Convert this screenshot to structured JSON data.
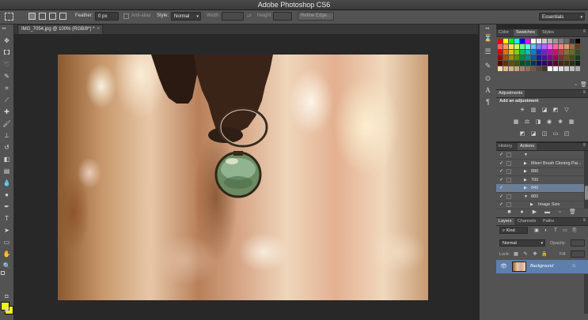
{
  "app": {
    "title": "Adobe Photoshop CS6"
  },
  "options_bar": {
    "feather_label": "Feather:",
    "feather_value": "0 px",
    "anti_alias_label": "Anti-alias",
    "style_label": "Style:",
    "style_value": "Normal",
    "width_label": "Width:",
    "height_label": "Height:",
    "refine_edge_label": "Refine Edge...",
    "workspace_value": "Essentials"
  },
  "document": {
    "tab_label": "IMG_7054.jpg @ 100% (RGB/8*) *"
  },
  "color_panel": {
    "tabs": [
      "Color",
      "Swatches",
      "Styles"
    ],
    "active_tab": "Swatches",
    "swatch_colors": [
      "#ff0000",
      "#ffff00",
      "#00ff00",
      "#00ffff",
      "#0000ff",
      "#ff00ff",
      "#ffffff",
      "#e6e6e6",
      "#cccccc",
      "#b3b3b3",
      "#999999",
      "#808080",
      "#666666",
      "#333333",
      "#000000",
      "#ff6060",
      "#ff9a55",
      "#ffe066",
      "#bfff66",
      "#66ff8a",
      "#66ffe6",
      "#66c2ff",
      "#7a7aff",
      "#b366ff",
      "#ff66e0",
      "#ff66a8",
      "#ff8080",
      "#d4a070",
      "#a06a3a",
      "#6b3c1a",
      "#e00000",
      "#e07000",
      "#e0c000",
      "#80d000",
      "#00c060",
      "#00c0c0",
      "#0080e0",
      "#2030d0",
      "#7020d0",
      "#c000c0",
      "#e00070",
      "#b04040",
      "#907030",
      "#607020",
      "#305030",
      "#a00000",
      "#a05000",
      "#a08a00",
      "#5a9000",
      "#008a44",
      "#008a8a",
      "#005aa0",
      "#14209a",
      "#500f9a",
      "#8a008a",
      "#a00050",
      "#803030",
      "#705020",
      "#405010",
      "#203820",
      "#600000",
      "#603000",
      "#605000",
      "#355800",
      "#005028",
      "#005050",
      "#003560",
      "#0c1260",
      "#300860",
      "#500050",
      "#600030",
      "#502020",
      "#403010",
      "#283008",
      "#102010",
      "#f5deb3",
      "#deb887",
      "#d2b48c",
      "#c4a484",
      "#a0826d",
      "#8b7355",
      "#6f5a45",
      "#5a4636",
      "#463628",
      "#ffffff",
      "#eeeeee",
      "#dddddd",
      "#cccccc",
      "#bbbbbb",
      "#aaaaaa"
    ]
  },
  "adjustments_panel": {
    "tab": "Adjustments",
    "heading": "Add an adjustment",
    "row1_icons": [
      "brightness-contrast-icon",
      "levels-icon",
      "curves-icon",
      "exposure-icon",
      "vibrance-icon"
    ],
    "row2_icons": [
      "hue-saturation-icon",
      "color-balance-icon",
      "black-white-icon",
      "photo-filter-icon",
      "channel-mixer-icon",
      "color-lookup-icon"
    ],
    "row3_icons": [
      "invert-icon",
      "posterize-icon",
      "threshold-icon",
      "gradient-map-icon",
      "selective-color-icon"
    ]
  },
  "actions_panel": {
    "tabs": [
      "History",
      "Actions"
    ],
    "active_tab": "Actions",
    "rows": [
      {
        "name": "",
        "indent": 1,
        "expanded": true,
        "selected": false
      },
      {
        "name": "Mixer Brush Cloning Pai...",
        "indent": 1,
        "expanded": false,
        "selected": false
      },
      {
        "name": "890",
        "indent": 1,
        "expanded": false,
        "selected": false
      },
      {
        "name": "700",
        "indent": 1,
        "expanded": false,
        "selected": false
      },
      {
        "name": "840",
        "indent": 1,
        "expanded": false,
        "selected": true
      },
      {
        "name": "800",
        "indent": 1,
        "expanded": true,
        "selected": false
      },
      {
        "name": "Image Size",
        "indent": 2,
        "expanded": false,
        "selected": false
      }
    ]
  },
  "layers_panel": {
    "tabs": [
      "Layers",
      "Channels",
      "Paths"
    ],
    "active_tab": "Layers",
    "kind_label": "Kind",
    "blend_mode": "Normal",
    "opacity_label": "Opacity:",
    "lock_label": "Lock:",
    "fill_label": "Fill:",
    "layers": [
      {
        "name": "Background",
        "visible": true,
        "locked": true
      }
    ]
  }
}
